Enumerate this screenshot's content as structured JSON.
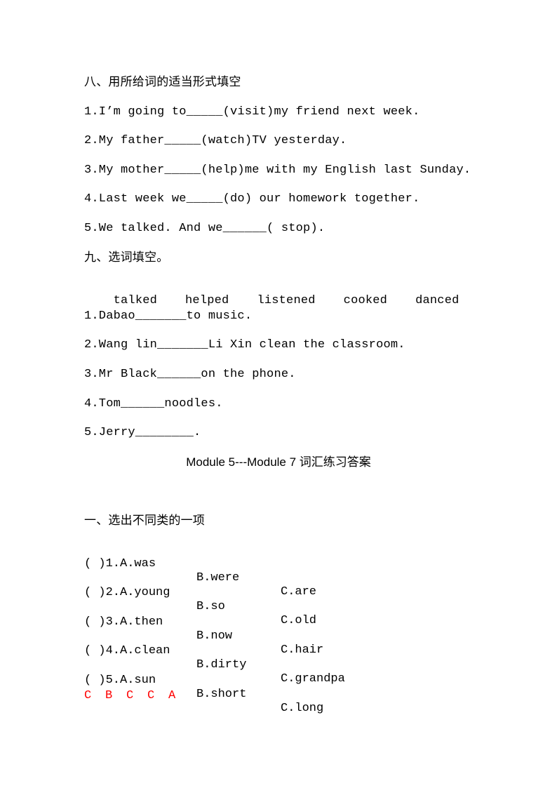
{
  "section8": {
    "heading": "八、用所给词的适当形式填空",
    "items": [
      "1.I’m going to_____(visit)my friend next week.",
      "2.My father_____(watch)TV yesterday.",
      "3.My mother_____(help)me with my English last Sunday.",
      "4.Last week we_____(do) our homework together.",
      "5.We talked. And we______( stop)."
    ]
  },
  "section9": {
    "heading": "九、选词填空。",
    "word_bank": [
      "talked",
      "helped",
      "listened",
      "cooked",
      "danced"
    ],
    "items": [
      "1.Dabao_______to music.",
      "2.Wang lin_______Li Xin clean the classroom.",
      "3.Mr Black______on the phone.",
      "4.Tom______noodles.",
      "5.Jerry________."
    ]
  },
  "answer_title": "Module 5---Module 7 词汇练习答案",
  "section1": {
    "heading": "一、选出不同类的一项",
    "items": [
      {
        "a": "( )1.A.was",
        "b": "B.were",
        "c": "C.are"
      },
      {
        "a": "( )2.A.young",
        "b": "B.so",
        "c": "C.old"
      },
      {
        "a": "( )3.A.then",
        "b": "B.now",
        "c": "C.hair"
      },
      {
        "a": "( )4.A.clean",
        "b": "B.dirty",
        "c": "C.grandpa"
      },
      {
        "a": "( )5.A.sun",
        "b": "B.short",
        "c": "C.long"
      }
    ],
    "answers": [
      "C",
      "B",
      "C",
      "C",
      "A"
    ],
    "answer_color": "#ff0000"
  }
}
